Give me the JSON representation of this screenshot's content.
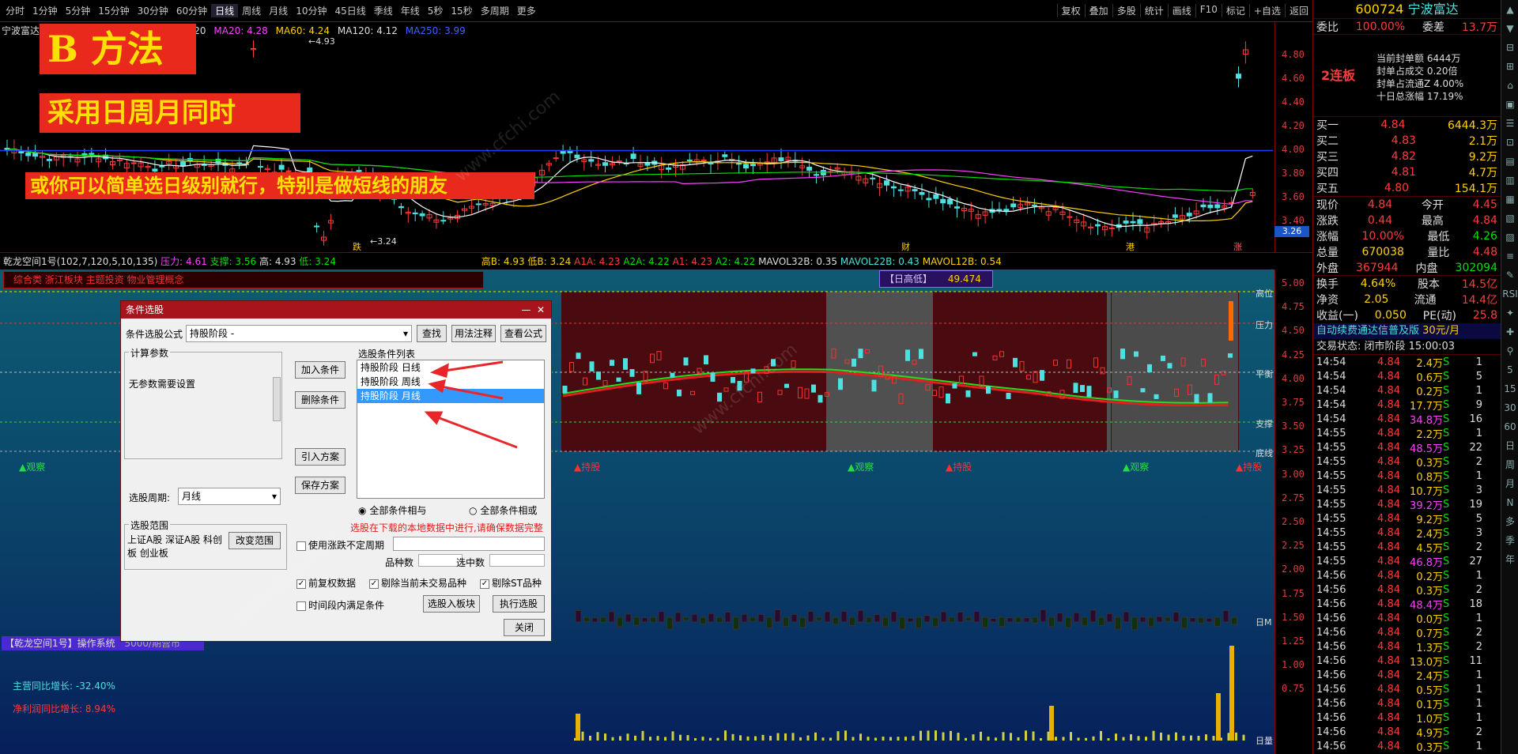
{
  "toolbar": {
    "left": [
      "分时",
      "1分钟",
      "5分钟",
      "15分钟",
      "30分钟",
      "60分钟",
      "日线",
      "周线",
      "月线",
      "10分钟",
      "45日线",
      "季线",
      "年线",
      "5秒",
      "15秒",
      "多周期",
      "更多"
    ],
    "active": "日线",
    "right": [
      "复权",
      "叠加",
      "多股",
      "统计",
      "画线",
      "F10",
      "标记",
      "+自选",
      "返回"
    ]
  },
  "ma_line": {
    "name": "宁波富达",
    "ma5": "4.20",
    "ma20": "MA20: 4.28",
    "ma60": "MA60: 4.24",
    "ma120": "MA120: 4.12",
    "ma250": "MA250: 3.99"
  },
  "overlays": {
    "title": "B 方法",
    "subtitle": "采用日周月同时",
    "note": "或你可以简单选日级别就行，特别是做短线的朋友"
  },
  "kline": {
    "high_label": "4.93",
    "low_label": "3.24",
    "y_ticks": [
      "4.80",
      "4.60",
      "4.40",
      "4.20",
      "4.00",
      "3.80",
      "3.60",
      "3.40"
    ],
    "price_tag": "3.26",
    "events": [
      "跌",
      "财",
      "港",
      "涨",
      "跌"
    ]
  },
  "indicator_line": {
    "name": "乾龙空间1号(102,7,120,5,10,135)",
    "ya": "压力: 4.61",
    "zc": "支撑: 3.56",
    "gao": "高: 4.93",
    "di": "低: 3.24",
    "gb": "高B: 4.93",
    "db": "低B: 3.24",
    "a1a": "A1A: 4.23",
    "a2a": "A2A: 4.22",
    "a1": "A1: 4.23",
    "a2": "A2: 4.22",
    "mv32": "MAVOL32B: 0.35",
    "mv22": "MAVOL22B: 0.43",
    "mv12": "MAVOL12B: 0.54"
  },
  "concept": "综合类 浙江板块 主题投资 物业管理概念",
  "rigao": {
    "label": "【日高低】",
    "value": "49.474"
  },
  "lower": {
    "y_ticks": [
      "5.00",
      "4.75",
      "4.50",
      "4.25",
      "4.00",
      "3.75",
      "3.50",
      "3.25",
      "3.00",
      "2.75",
      "2.50",
      "2.25",
      "2.00",
      "1.75",
      "1.50",
      "1.25",
      "1.00",
      "0.75"
    ],
    "right_labels": [
      "高位",
      "压力",
      "平衡",
      "支撑",
      "底线",
      "日M",
      "日量"
    ],
    "observe": [
      "观察",
      "观察",
      "观察",
      "观察"
    ],
    "hold": [
      "持股",
      "持股",
      "持股"
    ],
    "system": "【乾龙空间1号】操作系统",
    "sys_price": "5000/期营市",
    "growth1": "主营同比增长: -32.40%",
    "growth2": "净利润同比增长: 8.94%"
  },
  "dialog": {
    "title": "条件选股",
    "formula_label": "条件选股公式",
    "formula_value": "持股阶段  -",
    "find": "查找",
    "usage": "用法注释",
    "view": "查看公式",
    "params_title": "计算参数",
    "params_text": "无参数需要设置",
    "add": "加入条件",
    "del": "删除条件",
    "list_title": "选股条件列表",
    "conditions": [
      "持股阶段  日线",
      "持股阶段  周线",
      "持股阶段  月线"
    ],
    "selected_index": 2,
    "import": "引入方案",
    "save": "保存方案",
    "period_label": "选股周期:",
    "period_value": "月线",
    "all_and": "全部条件相与",
    "all_or": "全部条件相或",
    "warn": "选股在下载的本地数据中进行,请确保数据完整",
    "range_title": "选股范围",
    "range_text": "上证A股 深证A股 科创板 创业板",
    "change_range": "改变范围",
    "use_limit": "使用涨跌不定周期",
    "pz": "品种数",
    "xz": "选中数",
    "qfq": "前复权数据",
    "del_untraded": "剔除当前未交易品种",
    "del_st": "剔除ST品种",
    "in_period": "时间段内满足条件",
    "to_block": "选股入板块",
    "execute": "执行选股",
    "close": "关闭"
  },
  "quote": {
    "code": "600724",
    "name": "宁波富达",
    "wb_label": "委比",
    "wb": "100.00%",
    "wc_label": "委差",
    "wc": "13.7万",
    "limit_tag": "2连板",
    "seal_amount": "当前封单额 6444万",
    "seal_deal": "封单占成交 0.20倍",
    "seal_float": "封单占流通Z 4.00%",
    "ten_day": "十日总涨幅 17.19%",
    "book": [
      [
        "买一",
        "4.84",
        "6444.3万"
      ],
      [
        "买二",
        "4.83",
        "2.1万"
      ],
      [
        "买三",
        "4.82",
        "9.2万"
      ],
      [
        "买四",
        "4.81",
        "4.7万"
      ],
      [
        "买五",
        "4.80",
        "154.1万"
      ]
    ],
    "stats": [
      [
        "现价",
        "4.84",
        "今开",
        "4.45"
      ],
      [
        "涨跌",
        "0.44",
        "最高",
        "4.84"
      ],
      [
        "涨幅",
        "10.00%",
        "最低",
        "4.26"
      ],
      [
        "总量",
        "670038",
        "量比",
        "4.48"
      ],
      [
        "外盘",
        "367944",
        "内盘",
        "302094"
      ],
      [
        "换手",
        "4.64%",
        "股本",
        "14.5亿"
      ],
      [
        "净资",
        "2.05",
        "流通",
        "14.4亿"
      ],
      [
        "收益(一)",
        "0.050",
        "PE(动)",
        "25.8"
      ]
    ],
    "promo": "自动续费通达信普及版",
    "promo_price": "30元/月",
    "status": "交易状态: 闭市阶段 15:00:03",
    "ticks": [
      [
        "14:54",
        "4.84",
        "2.4万",
        "S",
        "1"
      ],
      [
        "14:54",
        "4.84",
        "0.6万",
        "S",
        "5"
      ],
      [
        "14:54",
        "4.84",
        "0.2万",
        "S",
        "1"
      ],
      [
        "14:54",
        "4.84",
        "17.7万",
        "S",
        "9"
      ],
      [
        "14:54",
        "4.84",
        "34.8万",
        "S",
        "16"
      ],
      [
        "14:55",
        "4.84",
        "2.2万",
        "S",
        "1"
      ],
      [
        "14:55",
        "4.84",
        "48.5万",
        "S",
        "22"
      ],
      [
        "14:55",
        "4.84",
        "0.3万",
        "S",
        "2"
      ],
      [
        "14:55",
        "4.84",
        "0.8万",
        "S",
        "1"
      ],
      [
        "14:55",
        "4.84",
        "10.7万",
        "S",
        "3"
      ],
      [
        "14:55",
        "4.84",
        "39.2万",
        "S",
        "19"
      ],
      [
        "14:55",
        "4.84",
        "9.2万",
        "S",
        "5"
      ],
      [
        "14:55",
        "4.84",
        "2.4万",
        "S",
        "3"
      ],
      [
        "14:55",
        "4.84",
        "4.5万",
        "S",
        "2"
      ],
      [
        "14:55",
        "4.84",
        "46.8万",
        "S",
        "27"
      ],
      [
        "14:56",
        "4.84",
        "0.2万",
        "S",
        "1"
      ],
      [
        "14:56",
        "4.84",
        "0.3万",
        "S",
        "2"
      ],
      [
        "14:56",
        "4.84",
        "48.4万",
        "S",
        "18"
      ],
      [
        "14:56",
        "4.84",
        "0.0万",
        "S",
        "1"
      ],
      [
        "14:56",
        "4.84",
        "0.7万",
        "S",
        "2"
      ],
      [
        "14:56",
        "4.84",
        "1.3万",
        "S",
        "2"
      ],
      [
        "14:56",
        "4.84",
        "13.0万",
        "S",
        "11"
      ],
      [
        "14:56",
        "4.84",
        "2.4万",
        "S",
        "1"
      ],
      [
        "14:56",
        "4.84",
        "0.5万",
        "S",
        "1"
      ],
      [
        "14:56",
        "4.84",
        "0.1万",
        "S",
        "1"
      ],
      [
        "14:56",
        "4.84",
        "1.0万",
        "S",
        "1"
      ],
      [
        "14:56",
        "4.84",
        "4.9万",
        "S",
        "2"
      ],
      [
        "14:56",
        "4.84",
        "0.3万",
        "S",
        "1"
      ]
    ]
  },
  "right_icons": [
    "5",
    "15",
    "30",
    "60",
    "日",
    "周",
    "月",
    "N",
    "多",
    "季",
    "年"
  ]
}
